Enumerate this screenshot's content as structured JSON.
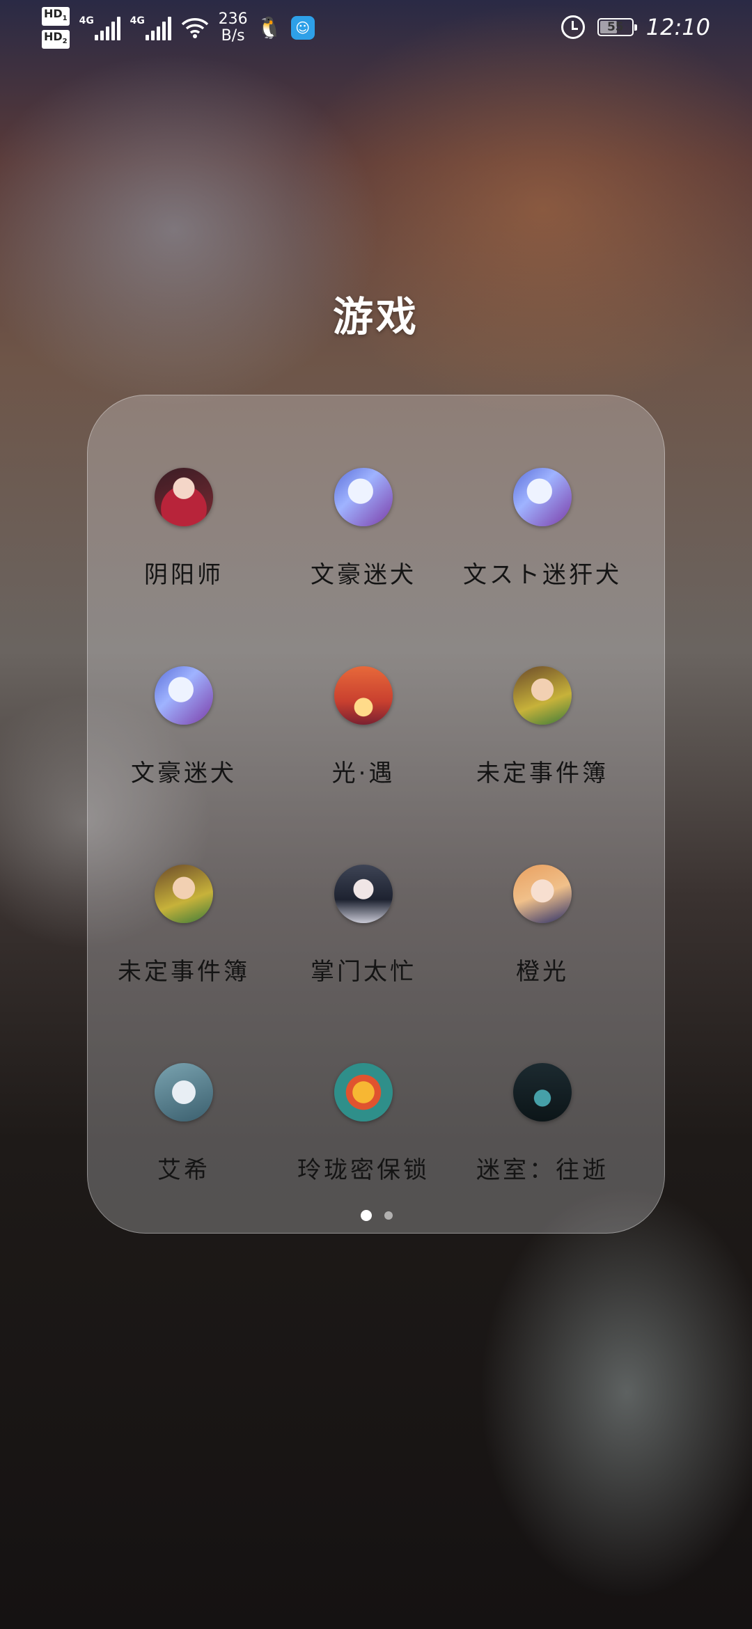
{
  "status_bar": {
    "sim1_label": "HD",
    "sim1_num": "1",
    "sim2_label": "HD",
    "sim2_num": "2",
    "network1": "4G",
    "network2": "4G",
    "speed_value": "236",
    "speed_unit": "B/s",
    "battery": "55",
    "battery_fraction": 0.55,
    "time": "12:10"
  },
  "folder": {
    "title": "游戏",
    "apps": [
      {
        "label": "阴阳师",
        "icon": "onmyoji-icon"
      },
      {
        "label": "文豪迷犬",
        "icon": "bungo-stray-dogs-icon"
      },
      {
        "label": "文スト迷犴犬",
        "icon": "bungo-stray-dogs-jp-icon"
      },
      {
        "label": "文豪迷犬",
        "icon": "bungo-stray-dogs-icon"
      },
      {
        "label": "光·遇",
        "icon": "sky-children-of-light-icon"
      },
      {
        "label": "未定事件簿",
        "icon": "tears-of-themis-icon"
      },
      {
        "label": "未定事件簿",
        "icon": "tears-of-themis-icon"
      },
      {
        "label": "掌门太忙",
        "icon": "master-too-busy-icon"
      },
      {
        "label": "橙光",
        "icon": "chengguang-icon"
      },
      {
        "label": "艾希",
        "icon": "icey-icon"
      },
      {
        "label": "玲珑密保锁",
        "icon": "password-lock-icon"
      },
      {
        "label": "迷室：往逝",
        "icon": "the-room-old-sins-icon"
      }
    ],
    "page_count": 2,
    "current_page": 1
  }
}
